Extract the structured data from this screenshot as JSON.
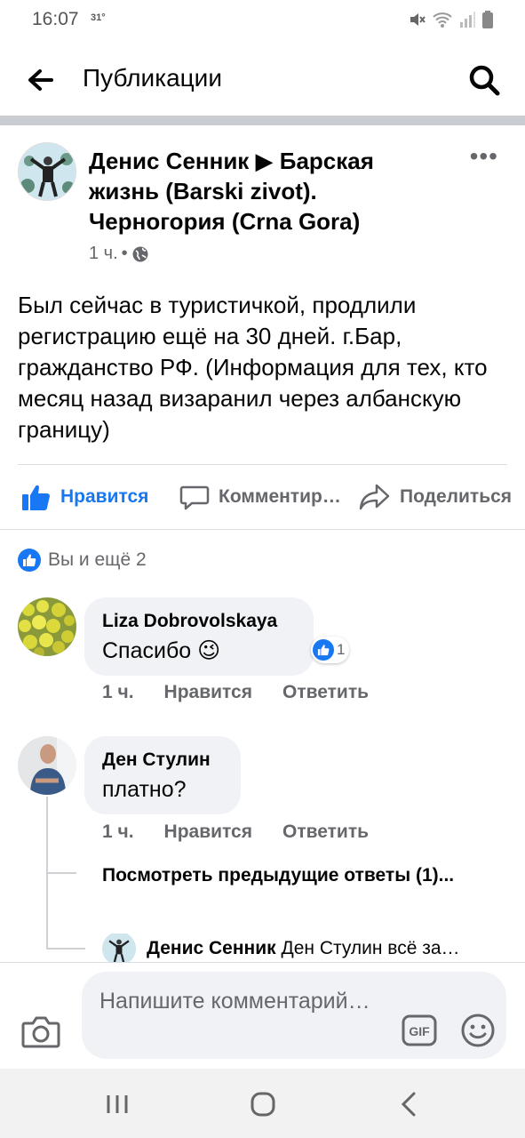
{
  "status_bar": {
    "time": "16:07",
    "temperature": "31°"
  },
  "header": {
    "title": "Публикации"
  },
  "post": {
    "author": "Денис Сенник ▶ Барская жизнь (Barski zivot). Черногория (Crna Gora)",
    "time": "1 ч.",
    "separator": "•",
    "text": "Был сейчас в туристичкой, продлили регистрацию ещё на 30 дней. г.Бар, гражданство РФ. (Информация для тех, кто месяц назад визаранил через албанскую границу)",
    "actions": {
      "like": "Нравится",
      "comment": "Комментир…",
      "share": "Поделиться"
    },
    "reactions": "Вы и ещё 2"
  },
  "comments": [
    {
      "name": "Liza Dobrovolskaya",
      "text": "Спасибо 😉",
      "time": "1 ч.",
      "like": "Нравится",
      "reply": "Ответить",
      "reaction_count": "1"
    },
    {
      "name": "Ден Стулин",
      "text": "платно?",
      "time": "1 ч.",
      "like": "Нравится",
      "reply": "Ответить"
    }
  ],
  "view_previous_replies": "Посмотреть предыдущие ответы (1)...",
  "reply_preview": {
    "name": "Денис Сенник",
    "text": "Ден Стулин всё за…"
  },
  "composer": {
    "placeholder": "Напишите комментарий…",
    "gif": "GIF"
  },
  "colors": {
    "accent": "#1877f2",
    "secondary_text": "#65676b",
    "bubble": "#f0f2f5"
  }
}
